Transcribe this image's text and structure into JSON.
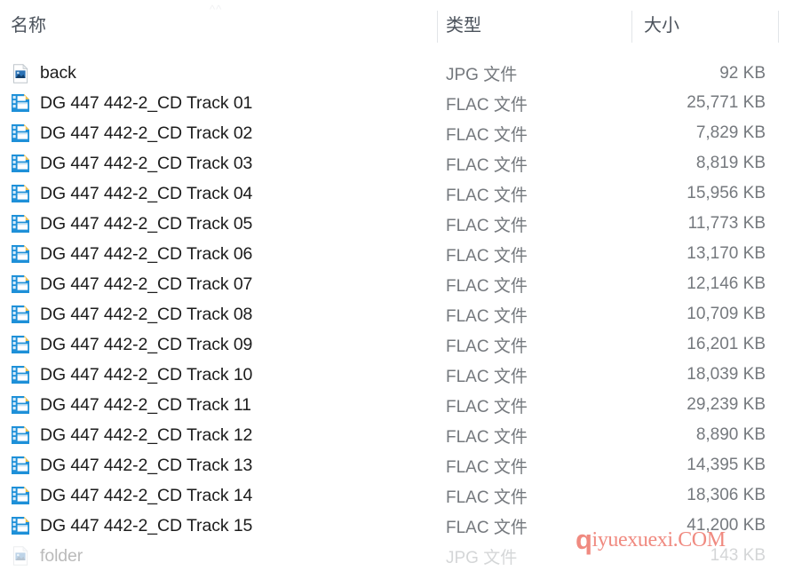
{
  "window": {
    "app": "file-explorer",
    "view_mode": "details"
  },
  "colors": {
    "header_text": "#4c535c",
    "name_text": "#1c1c1c",
    "meta_text": "#75797e",
    "separator": "#e2e5e8",
    "flac_icon_blue": "#1e90d8",
    "flac_icon_fold": "#f2c14b",
    "jpg_icon_blue": "#2a72b5",
    "watermark": "#f08a80",
    "background": "#ffffff"
  },
  "columns": {
    "name": "名称",
    "type": "类型",
    "size": "大小",
    "ghost_sort_marker": "^^"
  },
  "files": [
    {
      "name": "back",
      "type": "JPG 文件",
      "size": "92 KB",
      "icon": "jpg-file-icon"
    },
    {
      "name": "DG 447 442-2_CD Track 01",
      "type": "FLAC 文件",
      "size": "25,771 KB",
      "icon": "flac-file-icon"
    },
    {
      "name": "DG 447 442-2_CD Track 02",
      "type": "FLAC 文件",
      "size": "7,829 KB",
      "icon": "flac-file-icon"
    },
    {
      "name": "DG 447 442-2_CD Track 03",
      "type": "FLAC 文件",
      "size": "8,819 KB",
      "icon": "flac-file-icon"
    },
    {
      "name": "DG 447 442-2_CD Track 04",
      "type": "FLAC 文件",
      "size": "15,956 KB",
      "icon": "flac-file-icon"
    },
    {
      "name": "DG 447 442-2_CD Track 05",
      "type": "FLAC 文件",
      "size": "11,773 KB",
      "icon": "flac-file-icon"
    },
    {
      "name": "DG 447 442-2_CD Track 06",
      "type": "FLAC 文件",
      "size": "13,170 KB",
      "icon": "flac-file-icon"
    },
    {
      "name": "DG 447 442-2_CD Track 07",
      "type": "FLAC 文件",
      "size": "12,146 KB",
      "icon": "flac-file-icon"
    },
    {
      "name": "DG 447 442-2_CD Track 08",
      "type": "FLAC 文件",
      "size": "10,709 KB",
      "icon": "flac-file-icon"
    },
    {
      "name": "DG 447 442-2_CD Track 09",
      "type": "FLAC 文件",
      "size": "16,201 KB",
      "icon": "flac-file-icon"
    },
    {
      "name": "DG 447 442-2_CD Track 10",
      "type": "FLAC 文件",
      "size": "18,039 KB",
      "icon": "flac-file-icon"
    },
    {
      "name": "DG 447 442-2_CD Track 11",
      "type": "FLAC 文件",
      "size": "29,239 KB",
      "icon": "flac-file-icon"
    },
    {
      "name": "DG 447 442-2_CD Track 12",
      "type": "FLAC 文件",
      "size": "8,890 KB",
      "icon": "flac-file-icon"
    },
    {
      "name": "DG 447 442-2_CD Track 13",
      "type": "FLAC 文件",
      "size": "14,395 KB",
      "icon": "flac-file-icon"
    },
    {
      "name": "DG 447 442-2_CD Track 14",
      "type": "FLAC 文件",
      "size": "18,306 KB",
      "icon": "flac-file-icon"
    },
    {
      "name": "DG 447 442-2_CD Track 15",
      "type": "FLAC 文件",
      "size": "41,200 KB",
      "icon": "flac-file-icon"
    },
    {
      "name": "folder",
      "type": "JPG 文件",
      "size": "143 KB",
      "icon": "jpg-file-icon"
    }
  ],
  "watermark": {
    "lead": "q",
    "rest": "iyuexuexi.COM"
  }
}
